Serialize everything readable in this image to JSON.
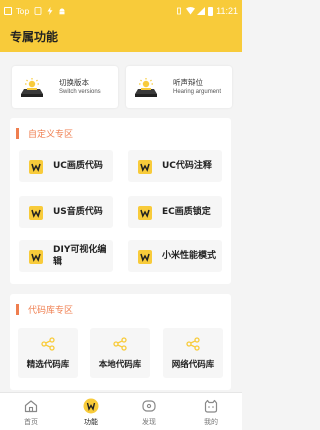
{
  "status_bar": {
    "carrier_label": "Top",
    "time": "11:21"
  },
  "header": {
    "title": "专属功能"
  },
  "top_cards": [
    {
      "title": "切换版本",
      "subtitle": "Switch versions",
      "icon": "lamp-icon"
    },
    {
      "title": "听声辩位",
      "subtitle": "Hearing argument",
      "icon": "lamp-icon"
    }
  ],
  "custom_section": {
    "title": "自定义专区",
    "items": [
      {
        "label": "UC画质代码",
        "icon": "w-logo-icon"
      },
      {
        "label": "UC代码注释",
        "icon": "w-logo-icon"
      },
      {
        "label": "US音质代码",
        "icon": "w-logo-icon"
      },
      {
        "label": "EC画质锁定",
        "icon": "w-logo-icon"
      },
      {
        "label": "DIY可视化编辑",
        "icon": "w-logo-icon"
      },
      {
        "label": "小米性能模式",
        "icon": "w-logo-icon"
      }
    ]
  },
  "library_section": {
    "title": "代码库专区",
    "items": [
      {
        "label": "精选代码库",
        "icon": "share-icon"
      },
      {
        "label": "本地代码库",
        "icon": "share-icon"
      },
      {
        "label": "网络代码库",
        "icon": "share-icon"
      }
    ]
  },
  "bottom_nav": {
    "items": [
      {
        "label": "首页",
        "icon": "home-icon",
        "active": false
      },
      {
        "label": "功能",
        "icon": "function-icon",
        "active": true
      },
      {
        "label": "发现",
        "icon": "discover-icon",
        "active": false
      },
      {
        "label": "我的",
        "icon": "profile-icon",
        "active": false
      }
    ]
  },
  "colors": {
    "accent_yellow": "#f8cb3a",
    "section_title_orange": "#ef7e4f",
    "page_background": "#f4f4f4"
  }
}
